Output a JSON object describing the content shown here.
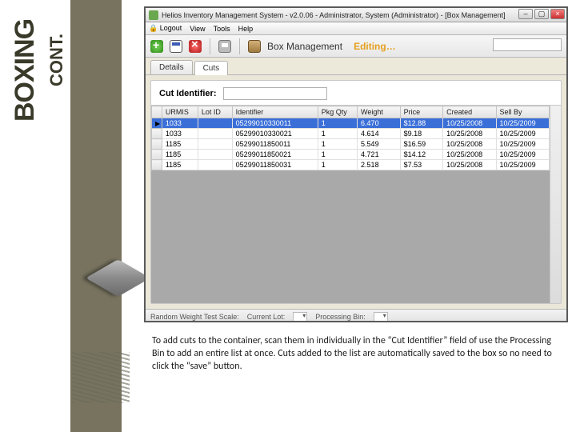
{
  "slide": {
    "title_main": "BOXING",
    "title_sub": "CONT."
  },
  "window": {
    "title": "Helios Inventory Management System - v2.0.06 - Administrator, System (Administrator) - [Box Management]"
  },
  "menu": {
    "logout": "Logout",
    "view": "View",
    "tools": "Tools",
    "help": "Help"
  },
  "toolbar": {
    "breadcrumb": "Box Management",
    "state": "Editing…",
    "search_placeholder": ""
  },
  "tabs": {
    "details": "Details",
    "cuts": "Cuts"
  },
  "cut_section": {
    "label": "Cut Identifier:",
    "value": ""
  },
  "grid": {
    "columns": [
      "URMIS",
      "Lot ID",
      "Identifier",
      "Pkg Qty",
      "Weight",
      "Price",
      "Created",
      "Sell By"
    ],
    "rows": [
      {
        "urmis": "1033",
        "lot": "",
        "ident": "05299010330011",
        "pkg": "1",
        "weight": "6.470",
        "price": "$12.88",
        "created": "10/25/2008",
        "sellby": "10/25/2009"
      },
      {
        "urmis": "1033",
        "lot": "",
        "ident": "05299010330021",
        "pkg": "1",
        "weight": "4.614",
        "price": "$9.18",
        "created": "10/25/2008",
        "sellby": "10/25/2009"
      },
      {
        "urmis": "1185",
        "lot": "",
        "ident": "05299011850011",
        "pkg": "1",
        "weight": "5.549",
        "price": "$16.59",
        "created": "10/25/2008",
        "sellby": "10/25/2009"
      },
      {
        "urmis": "1185",
        "lot": "",
        "ident": "05299011850021",
        "pkg": "1",
        "weight": "4.721",
        "price": "$14.12",
        "created": "10/25/2008",
        "sellby": "10/25/2009"
      },
      {
        "urmis": "1185",
        "lot": "",
        "ident": "05299011850031",
        "pkg": "1",
        "weight": "2.518",
        "price": "$7.53",
        "created": "10/25/2008",
        "sellby": "10/25/2009"
      }
    ]
  },
  "status": {
    "s1": "Random Weight Test Scale:",
    "s2": "Current Lot:",
    "s2_val": "",
    "s3": "Processing Bin:",
    "s3_val": ""
  },
  "caption": "To add cuts to the container, scan them in individually in the “Cut Identifier” field of use the Processing Bin to add an entire list at once. Cuts added to the list are automatically saved to the box so no need to click the “save” button."
}
